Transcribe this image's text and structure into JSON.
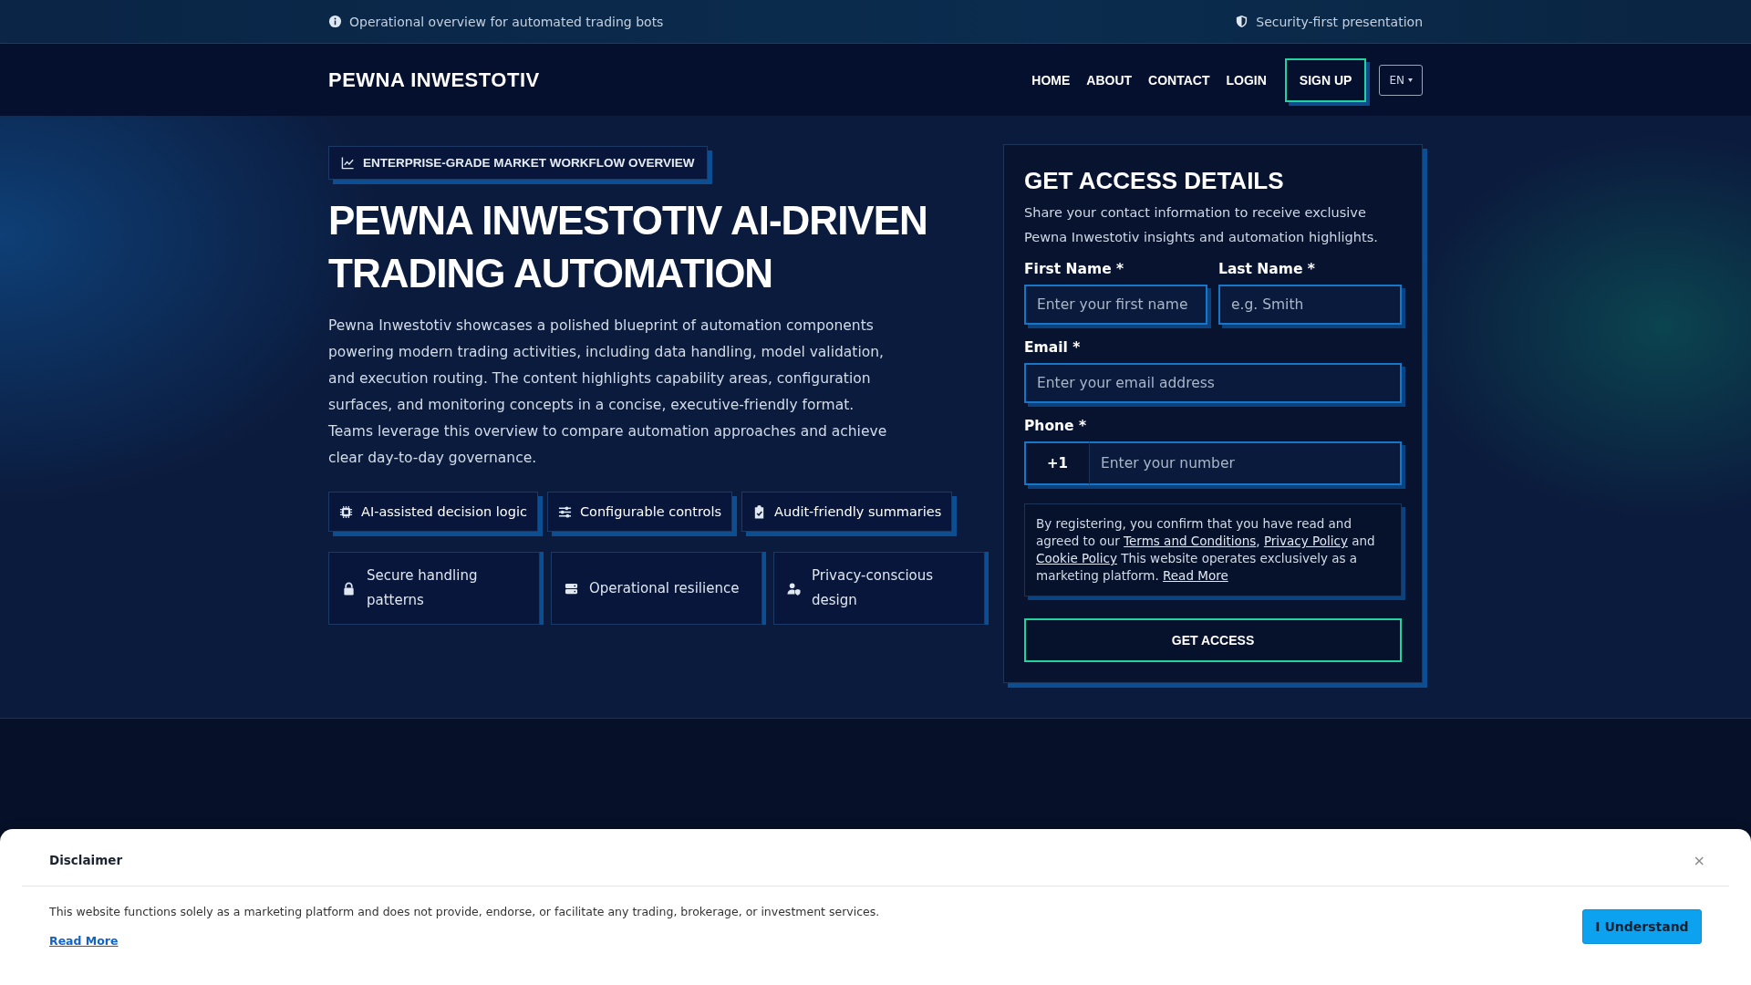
{
  "top_bar": {
    "left": {
      "text": "Operational overview for automated trading bots"
    },
    "right": {
      "text": "Security-first presentation"
    }
  },
  "nav": {
    "brand": "PEWNA INWESTOTIV",
    "links": [
      {
        "label": "HOME"
      },
      {
        "label": "ABOUT"
      },
      {
        "label": "CONTACT"
      },
      {
        "label": "LOGIN"
      }
    ],
    "signup": "SIGN UP",
    "language": "EN"
  },
  "hero": {
    "badge": "ENTERPRISE-GRADE MARKET WORKFLOW OVERVIEW",
    "title": "PEWNA INWESTOTIV AI-DRIVEN TRADING AUTOMATION",
    "paragraph": "Pewna Inwestotiv showcases a polished blueprint of automation components powering modern trading activities, including data handling, model validation, and execution routing. The content highlights capability areas, configuration surfaces, and monitoring concepts in a concise, executive-friendly format. Teams leverage this overview to compare automation approaches and achieve clear day-to-day governance.",
    "features": [
      {
        "kind": "chip",
        "label": "AI-assisted decision logic"
      },
      {
        "kind": "sliders",
        "label": "Configurable controls"
      },
      {
        "kind": "clipboard",
        "label": "Audit-friendly summaries"
      }
    ],
    "highlights": [
      {
        "kind": "lock",
        "label": "Secure handling patterns"
      },
      {
        "kind": "server",
        "label": "Operational resilience"
      },
      {
        "kind": "user-shield",
        "label": "Privacy-conscious design"
      }
    ]
  },
  "form": {
    "title": "GET ACCESS DETAILS",
    "description": "Share your contact information to receive exclusive Pewna Inwestotiv insights and automation highlights.",
    "first_name": {
      "label": "First Name *",
      "placeholder": "Enter your first name"
    },
    "last_name": {
      "label": "Last Name *",
      "placeholder": "e.g. Smith"
    },
    "email": {
      "label": "Email *",
      "placeholder": "Enter your email address"
    },
    "phone": {
      "label": "Phone *",
      "code": "+1",
      "placeholder": "Enter your number"
    },
    "consent": [
      {
        "kind": "text",
        "text": "By registering, you confirm that you have read and agreed to our "
      },
      {
        "kind": "link",
        "text": "Terms and Conditions"
      },
      {
        "kind": "text",
        "text": ", "
      },
      {
        "kind": "link",
        "text": "Privacy Policy"
      },
      {
        "kind": "text",
        "text": " and "
      },
      {
        "kind": "link",
        "text": "Cookie Policy"
      },
      {
        "kind": "text",
        "text": " This website operates exclusively as a marketing platform. "
      },
      {
        "kind": "link",
        "text": "Read More"
      }
    ],
    "submit": "GET ACCESS"
  },
  "disclaimer": {
    "title": "Disclaimer",
    "close": "×",
    "text": "This website functions solely as a marketing platform and does not provide, endorse, or facilitate any trading, brokerage, or investment services.",
    "read_more": "Read More",
    "button": "I Understand"
  }
}
